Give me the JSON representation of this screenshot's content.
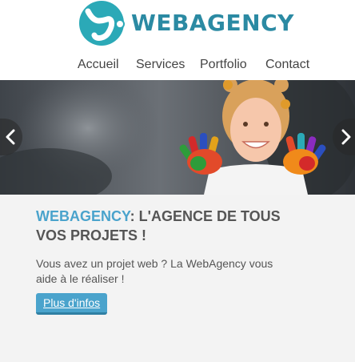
{
  "brand": {
    "name": "WEBAGENCY",
    "color": "#2b8aa3"
  },
  "nav": {
    "items": [
      {
        "label": "Accueil"
      },
      {
        "label": "Services"
      },
      {
        "label": "Portfolio"
      },
      {
        "label": "Contact"
      }
    ]
  },
  "slider": {
    "prev_icon": "chevron-left-icon",
    "next_icon": "chevron-right-icon",
    "image": "smiling girl with paint-covered hands"
  },
  "hero": {
    "headline_brand": "WEBAGENCY",
    "headline_rest": ": L'AGENCE DE TOUS VOS PROJETS !",
    "intro": "Vous avez un projet web ? La WebAgency vous aide à le réaliser !",
    "cta_label": "Plus d'infos",
    "accent_color": "#4aa3cc"
  }
}
